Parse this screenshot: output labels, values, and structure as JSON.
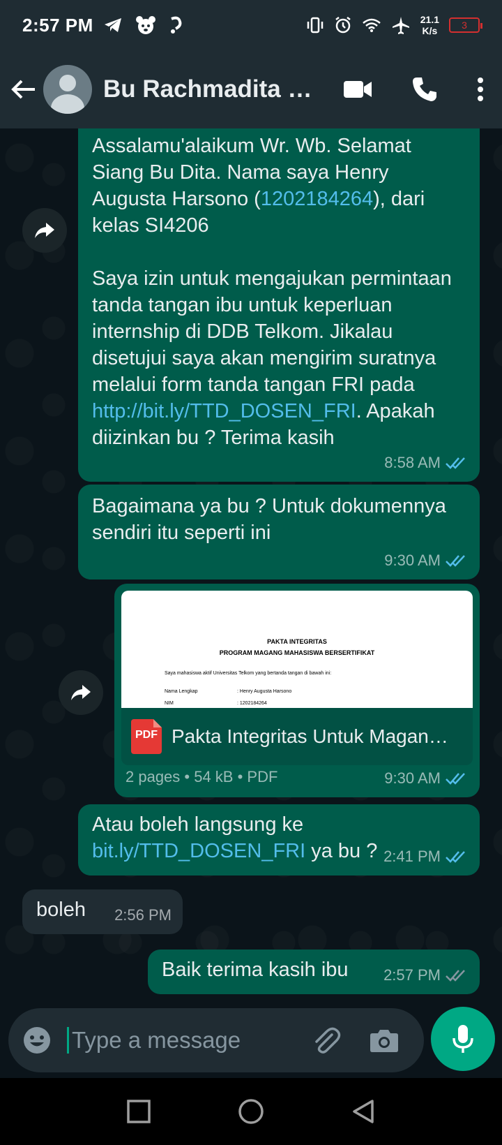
{
  "status_bar": {
    "time": "2:57 PM",
    "net_speed_value": "21.1",
    "net_speed_unit": "K/s",
    "battery": "3"
  },
  "header": {
    "contact_name": "Bu Rachmadita Kurniawati"
  },
  "messages": {
    "m1": {
      "p1a": "Assalamu'alaikum Wr. Wb. Selamat Siang Bu Dita. Nama saya Henry Augusta Harsono (",
      "p1_link": "1202184264",
      "p1b": "), dari kelas SI4206",
      "p2a": "Saya izin untuk mengajukan permintaan tanda tangan ibu untuk keperluan internship di DDB Telkom. Jikalau disetujui saya akan mengirim suratnya melalui form tanda tangan FRI pada ",
      "p2_link": "http://bit.ly/TTD_DOSEN_FRI",
      "p2b": ". Apakah diizinkan bu ? Terima kasih",
      "time": "8:58 AM"
    },
    "m2": {
      "text": "Bagaimana ya bu ? Untuk dokumennya sendiri itu seperti ini",
      "time": "9:30 AM"
    },
    "m3": {
      "preview_title1": "PAKTA INTEGRITAS",
      "preview_title2": "PROGRAM MAGANG MAHASISWA BERSERTIFIKAT",
      "preview_intro": "Saya mahasiswa aktif Universitas Telkom yang bertanda tangan di bawah ini:",
      "preview_label_name": "Nama Lengkap",
      "preview_value_name": ": Henry Augusta Harsono",
      "preview_label_nim": "NIM",
      "preview_value_nim": ": 1202184264",
      "pdf_badge": "PDF",
      "file_name": "Pakta Integritas Untuk Magang Mahasiswa Bersertifikat.pdf",
      "file_info": "2 pages • 54 kB • PDF",
      "time": "9:30 AM"
    },
    "m4": {
      "text_a": "Atau boleh langsung ke ",
      "link": "bit.ly/TTD_DOSEN_FRI",
      "text_b": " ya bu ?",
      "time": "2:41 PM"
    },
    "m5": {
      "text": "boleh",
      "time": "2:56 PM"
    },
    "m6": {
      "text": "Baik terima kasih ibu",
      "time": "2:57 PM"
    }
  },
  "composer": {
    "placeholder": "Type a message"
  },
  "colors": {
    "outgoing": "#005c4b",
    "incoming": "#202c33",
    "accent": "#00a884",
    "link": "#53bdeb",
    "read_tick": "#53bdeb"
  }
}
